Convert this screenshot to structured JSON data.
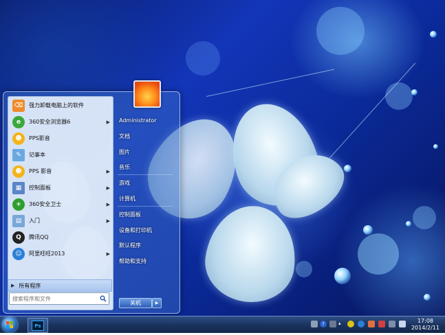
{
  "start_menu": {
    "programs": [
      {
        "label": "强力卸载电脑上的软件",
        "icon": "uninstall-icon",
        "color": "#f08a2a",
        "has_submenu": false
      },
      {
        "label": "360安全浏览器6",
        "icon": "browser-360-icon",
        "color": "#3aa83a",
        "has_submenu": true
      },
      {
        "label": "PPS影音",
        "icon": "pps-icon",
        "color": "#f3b41a",
        "has_submenu": false
      },
      {
        "label": "记事本",
        "icon": "notepad-icon",
        "color": "#6aa9e0",
        "has_submenu": false
      },
      {
        "label": "PPS 影音",
        "icon": "pps-icon",
        "color": "#f3b41a",
        "has_submenu": true
      },
      {
        "label": "控制面板",
        "icon": "control-panel-icon",
        "color": "#5a86c8",
        "has_submenu": true
      },
      {
        "label": "360安全卫士",
        "icon": "guard-360-icon",
        "color": "#2f9e2f",
        "has_submenu": true
      },
      {
        "label": "入门",
        "icon": "getting-started-icon",
        "color": "#7aa7d8",
        "has_submenu": true
      },
      {
        "label": "腾讯QQ",
        "icon": "qq-icon",
        "color": "#222222",
        "has_submenu": false
      },
      {
        "label": "阿里旺旺2013",
        "icon": "aliwangwang-icon",
        "color": "#2a7fd6",
        "has_submenu": true
      }
    ],
    "all_programs": "所有程序",
    "search_placeholder": "搜索程序和文件",
    "right_items": {
      "user": "Administrator",
      "documents": "文档",
      "pictures": "图片",
      "music": "音乐",
      "games": "游戏",
      "computer": "计算机",
      "control_panel": "控制面板",
      "devices": "设备和打印机",
      "default_programs": "默认程序",
      "help": "帮助和支持"
    },
    "shutdown": "关机"
  },
  "taskbar": {
    "pinned": [
      {
        "name": "Adobe Photoshop",
        "icon": "photoshop-icon",
        "label": "Ps"
      }
    ],
    "clock_time": "17:08",
    "clock_date": "2014/2/11"
  },
  "colors": {
    "accent": "#2f5fb8",
    "taskbar": "#1b345f"
  }
}
